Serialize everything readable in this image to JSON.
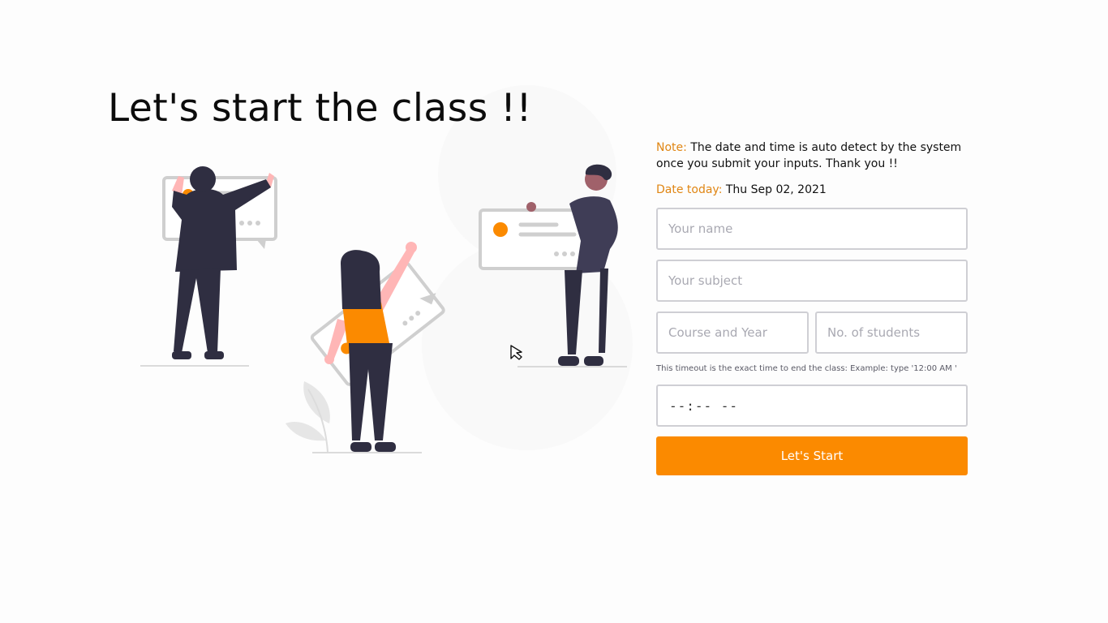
{
  "page": {
    "title": "Let's start the class !!"
  },
  "form": {
    "note_label": "Note:",
    "note_text": "The date and time is auto detect by the system once you submit your inputs. Thank you !!",
    "date_label": "Date today:",
    "date_value": "Thu Sep 02, 2021",
    "name_placeholder": "Your name",
    "subject_placeholder": "Your subject",
    "course_placeholder": "Course and Year",
    "students_placeholder": "No. of students",
    "timeout_hint": "This timeout is the exact time to end the class: Example: type '12:00 AM '",
    "time_value": "--:-- --",
    "submit_label": "Let's Start"
  },
  "colors": {
    "accent": "#fb8a00",
    "label_accent": "#e08614",
    "figure_dark": "#2f2e41",
    "skin": "#ffb6b6"
  }
}
